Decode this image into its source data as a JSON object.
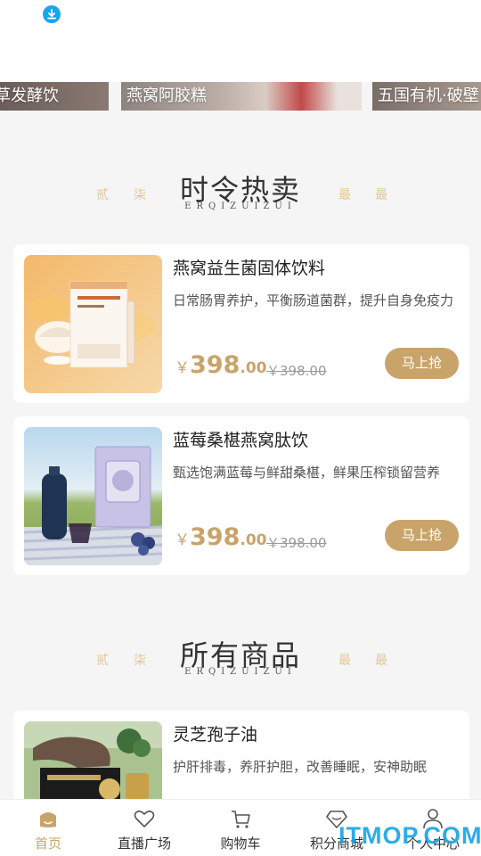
{
  "banners": [
    "草发酵饮",
    "燕窝阿胶糕",
    "五国有机·破壁"
  ],
  "sections": [
    {
      "title": "时令热卖",
      "subtitle": "ERQIZUIZUI",
      "deco": [
        "贰",
        "柒",
        "最",
        "最"
      ]
    },
    {
      "title": "所有商品",
      "subtitle": "ERQIZUIZUI",
      "deco": [
        "贰",
        "柒",
        "最",
        "最"
      ]
    }
  ],
  "hot_products": [
    {
      "name": "燕窝益生菌固体饮料",
      "desc": "日常肠胃养护，平衡肠道菌群，提升自身免疫力",
      "currency": "￥",
      "price_int": "398",
      "price_dec": ".00",
      "orig_price": "￥398.00",
      "buy_label": "马上抢"
    },
    {
      "name": "蓝莓桑椹燕窝肽饮",
      "desc": "甄选饱满蓝莓与鲜甜桑椹，鲜果压榨锁留营养",
      "currency": "￥",
      "price_int": "398",
      "price_dec": ".00",
      "orig_price": "￥398.00",
      "buy_label": "马上抢"
    }
  ],
  "all_products": [
    {
      "name": "灵芝孢子油",
      "desc": "护肝排毒，养肝护胆，改善睡眠，安神助眠"
    }
  ],
  "tabs": [
    {
      "label": "首页",
      "icon": "home-icon",
      "active": true
    },
    {
      "label": "直播广场",
      "icon": "heart-icon"
    },
    {
      "label": "购物车",
      "icon": "cart-icon"
    },
    {
      "label": "积分商城",
      "icon": "diamond-icon"
    },
    {
      "label": "个人中心",
      "icon": "user-icon"
    }
  ],
  "watermark": "ITMOP.COM",
  "colors": {
    "accent": "#c9a46a",
    "download_badge": "#1aa6e8"
  }
}
